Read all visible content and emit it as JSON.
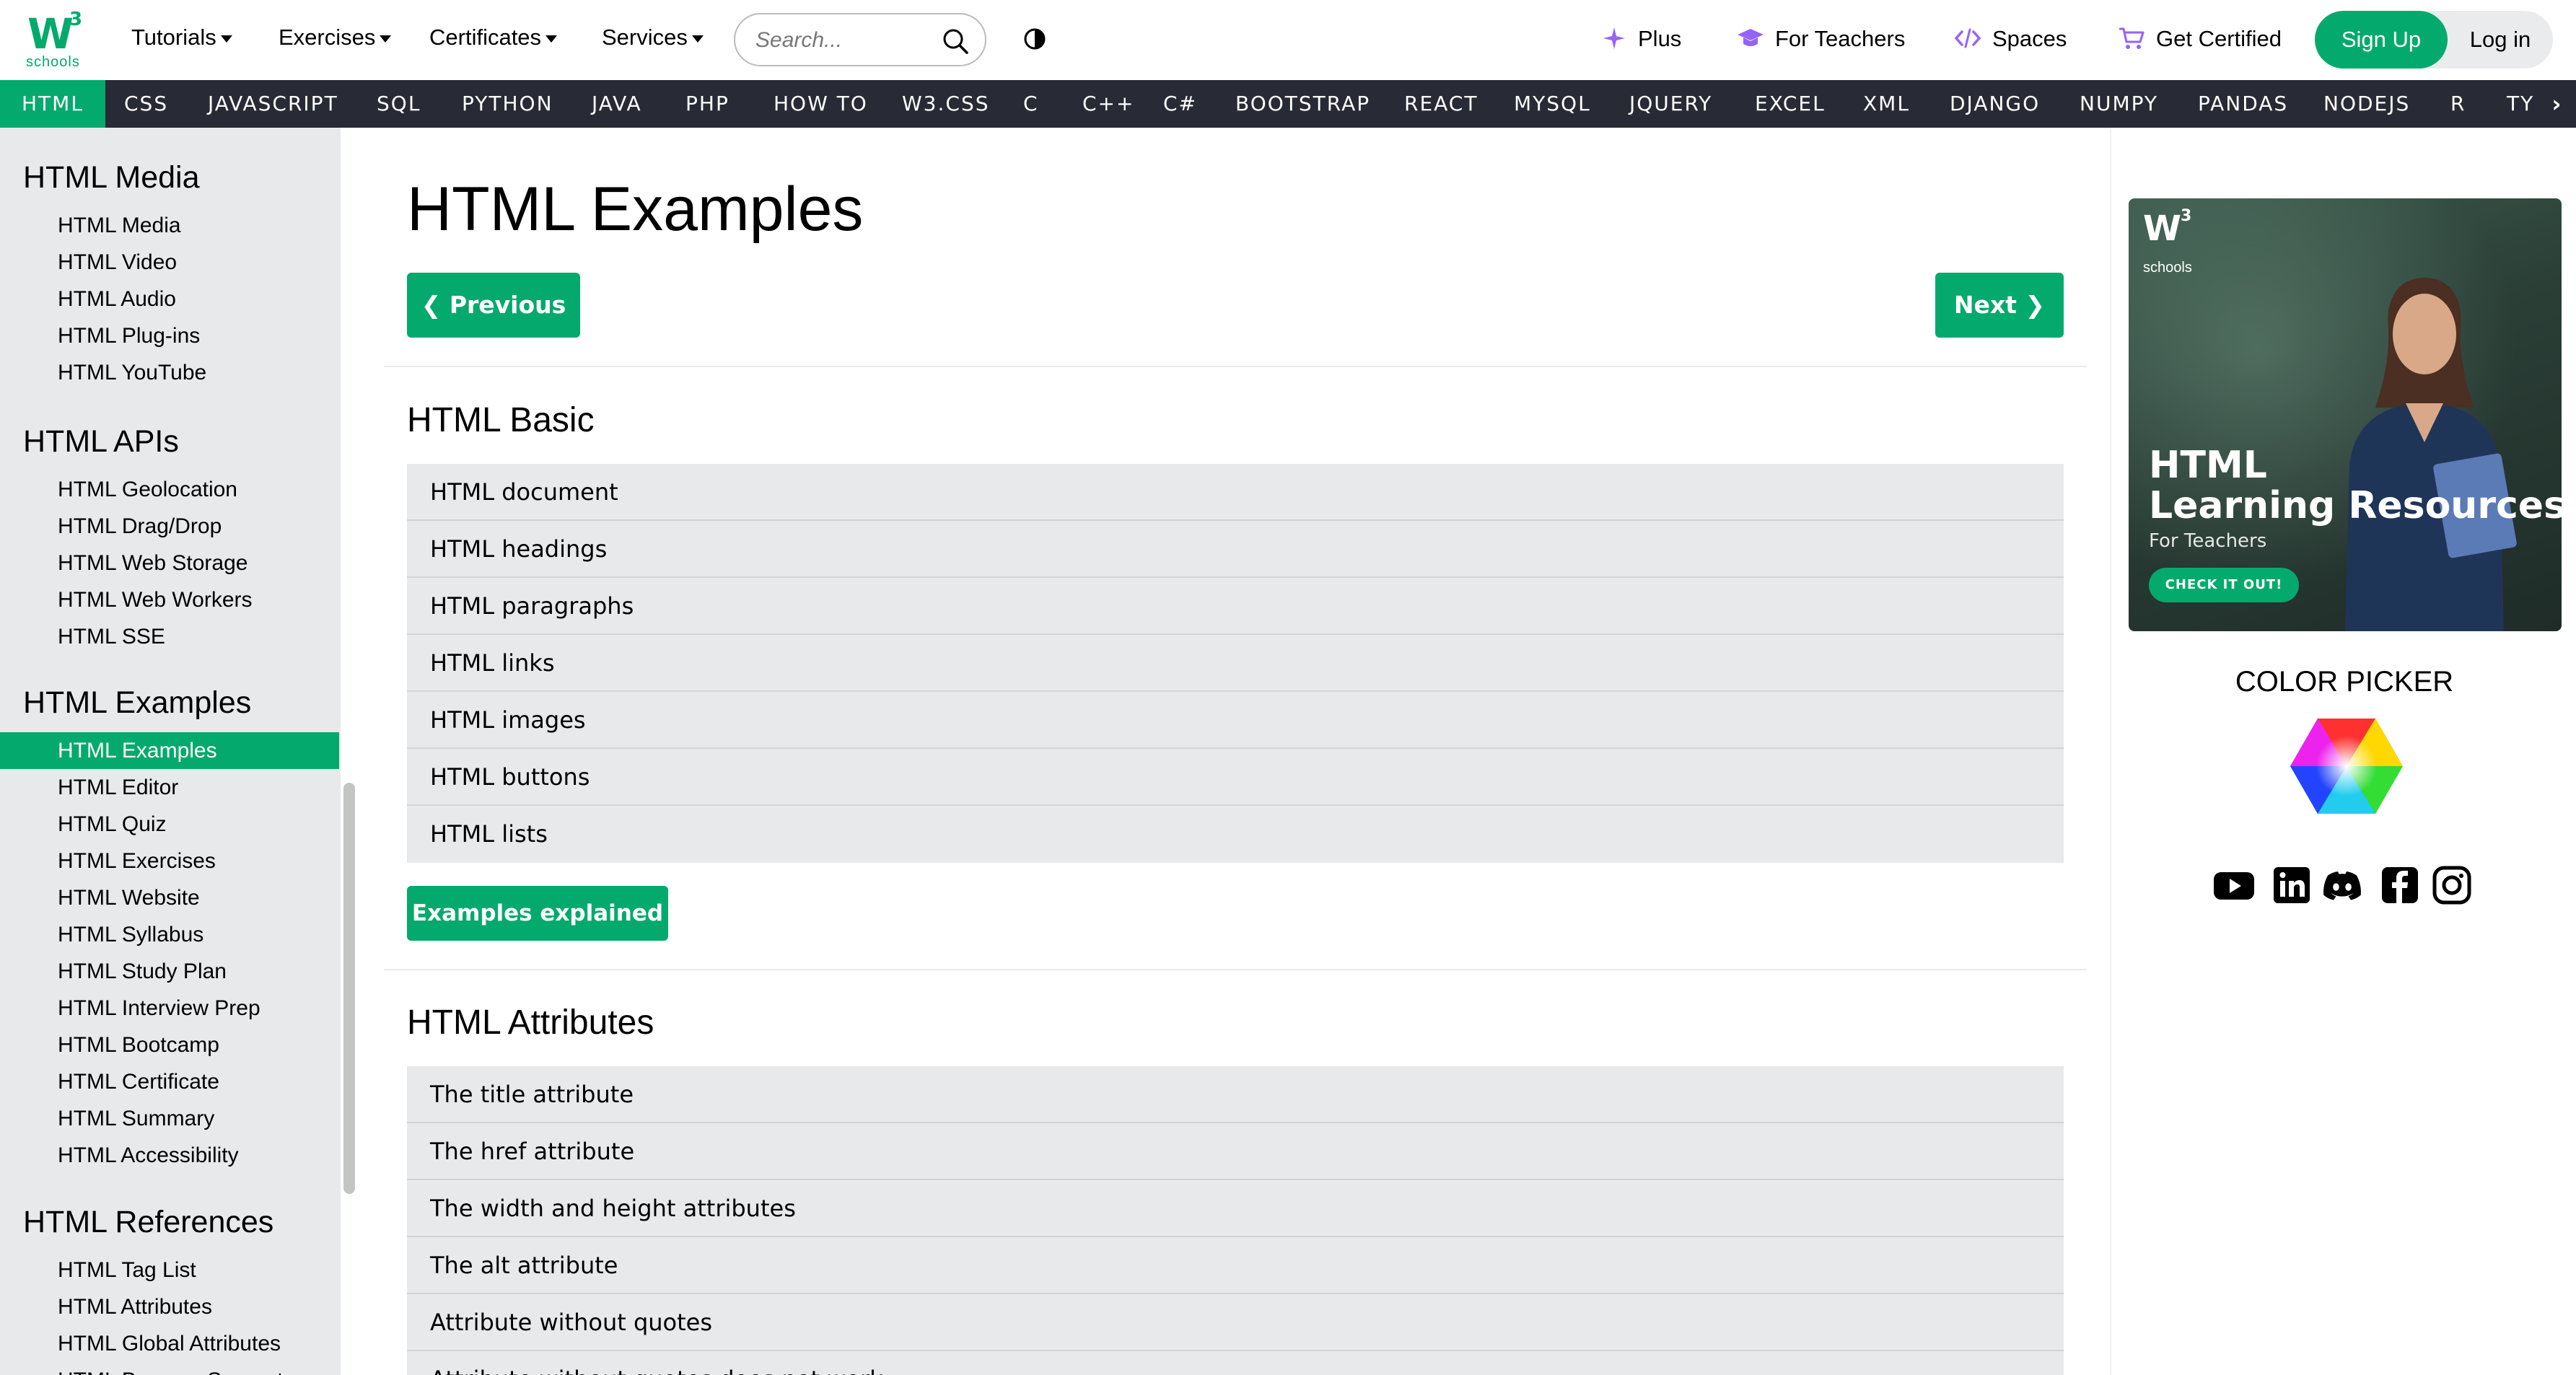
{
  "header": {
    "logo_main": "W",
    "logo_sup": "3",
    "logo_sub": "schools",
    "nav": [
      {
        "label": "Tutorials"
      },
      {
        "label": "Exercises"
      },
      {
        "label": "Certificates"
      },
      {
        "label": "Services"
      }
    ],
    "search_placeholder": "Search...",
    "links": [
      {
        "label": "Plus"
      },
      {
        "label": "For Teachers"
      },
      {
        "label": "Spaces"
      },
      {
        "label": "Get Certified"
      }
    ],
    "signup": "Sign Up",
    "login": "Log in"
  },
  "subnav": {
    "items": [
      "HTML",
      "CSS",
      "JAVASCRIPT",
      "SQL",
      "PYTHON",
      "JAVA",
      "PHP",
      "HOW TO",
      "W3.CSS",
      "C",
      "C++",
      "C#",
      "BOOTSTRAP",
      "REACT",
      "MYSQL",
      "JQUERY",
      "EXCEL",
      "XML",
      "DJANGO",
      "NUMPY",
      "PANDAS",
      "NODEJS",
      "R",
      "TY"
    ],
    "active": "HTML",
    "arrow": "›"
  },
  "sidebar": {
    "sections": [
      {
        "heading": "HTML Media",
        "items": [
          "HTML Media",
          "HTML Video",
          "HTML Audio",
          "HTML Plug-ins",
          "HTML YouTube"
        ]
      },
      {
        "heading": "HTML APIs",
        "items": [
          "HTML Geolocation",
          "HTML Drag/Drop",
          "HTML Web Storage",
          "HTML Web Workers",
          "HTML SSE"
        ]
      },
      {
        "heading": "HTML Examples",
        "items": [
          "HTML Examples",
          "HTML Editor",
          "HTML Quiz",
          "HTML Exercises",
          "HTML Website",
          "HTML Syllabus",
          "HTML Study Plan",
          "HTML Interview Prep",
          "HTML Bootcamp",
          "HTML Certificate",
          "HTML Summary",
          "HTML Accessibility"
        ]
      },
      {
        "heading": "HTML References",
        "items": [
          "HTML Tag List",
          "HTML Attributes",
          "HTML Global Attributes",
          "HTML Browser Support"
        ]
      }
    ],
    "active_item": "HTML Examples"
  },
  "main": {
    "title": "HTML Examples",
    "prev_label": "❮ Previous",
    "next_label": "Next ❯",
    "sections": [
      {
        "heading": "HTML Basic",
        "items": [
          "HTML document",
          "HTML headings",
          "HTML paragraphs",
          "HTML links",
          "HTML images",
          "HTML buttons",
          "HTML lists"
        ],
        "button": "Examples explained"
      },
      {
        "heading": "HTML Attributes",
        "items": [
          "The title attribute",
          "The href attribute",
          "The width and height attributes",
          "The alt attribute",
          "Attribute without quotes",
          "Attribute without quotes does not work"
        ]
      }
    ]
  },
  "rightcol": {
    "ad": {
      "brand_main": "W",
      "brand_sup": "3",
      "brand_sub": "schools",
      "line1": "HTML",
      "line2": "Learning Resources",
      "line3": "For Teachers",
      "cta": "CHECK IT OUT!"
    },
    "color_picker_title": "COLOR PICKER",
    "social_icons": [
      "youtube-icon",
      "linkedin-icon",
      "discord-icon",
      "facebook-icon",
      "instagram-icon"
    ]
  },
  "colors": {
    "brand_green": "#04AA6D",
    "subnav_bg": "#282A35",
    "sidebar_bg": "#E7E9EB",
    "list_bg": "#E7E9EB",
    "plus_purple": "#9763f6"
  }
}
